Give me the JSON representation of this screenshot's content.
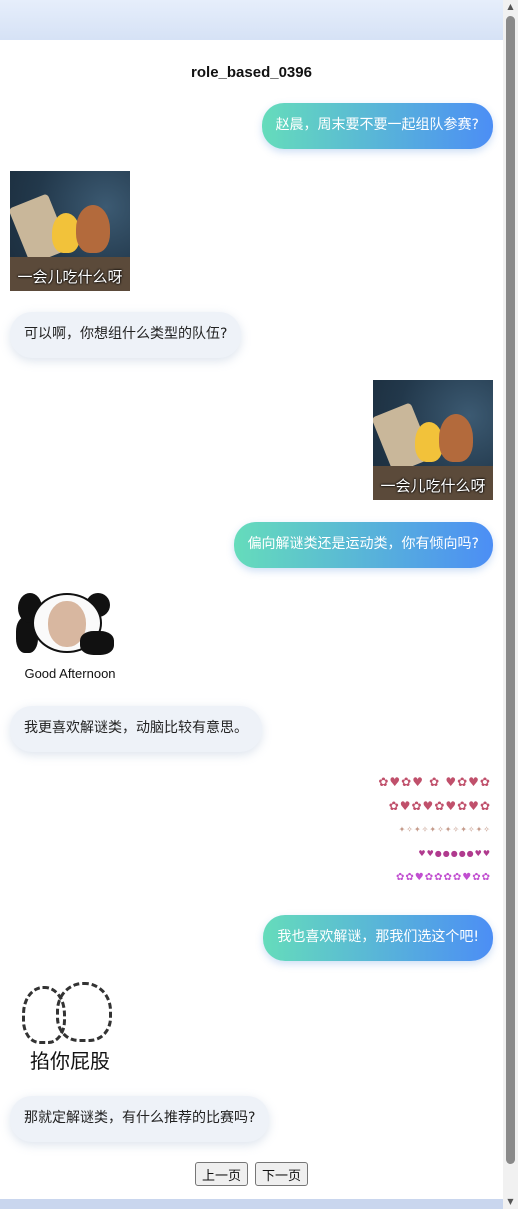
{
  "page": {
    "title": "role_based_0396"
  },
  "messages": [
    {
      "side": "right",
      "type": "text",
      "text": "赵晨，周末要不要一起组队参赛?"
    },
    {
      "side": "left",
      "type": "sticker",
      "sticker": "tom-and-jerry-sticker",
      "caption": "一会儿吃什么呀"
    },
    {
      "side": "left",
      "type": "text",
      "text": "可以啊，你想组什么类型的队伍?"
    },
    {
      "side": "right",
      "type": "sticker",
      "sticker": "tom-and-jerry-sticker",
      "caption": "一会儿吃什么呀"
    },
    {
      "side": "right",
      "type": "text",
      "text": "偏向解谜类还是运动类，你有倾向吗?"
    },
    {
      "side": "left",
      "type": "sticker",
      "sticker": "panda-meme-sticker",
      "caption": "Good Afternoon"
    },
    {
      "side": "left",
      "type": "text",
      "text": "我更喜欢解谜类，动脑比较有意思。"
    },
    {
      "side": "right",
      "type": "sticker",
      "sticker": "glitter-text-sticker"
    },
    {
      "side": "right",
      "type": "text",
      "text": "我也喜欢解谜，那我们选这个吧!"
    },
    {
      "side": "left",
      "type": "sticker",
      "sticker": "bears-sketch-sticker",
      "caption": "掐你屁股"
    },
    {
      "side": "left",
      "type": "text",
      "text": "那就定解谜类，有什么推荐的比赛吗?"
    }
  ],
  "pager": {
    "prev_label": "上一页",
    "next_label": "下一页"
  },
  "colors": {
    "bubble_right_start": "#65dcbb",
    "bubble_right_end": "#4c8ef5",
    "bubble_left_bg": "#eef2f8"
  }
}
